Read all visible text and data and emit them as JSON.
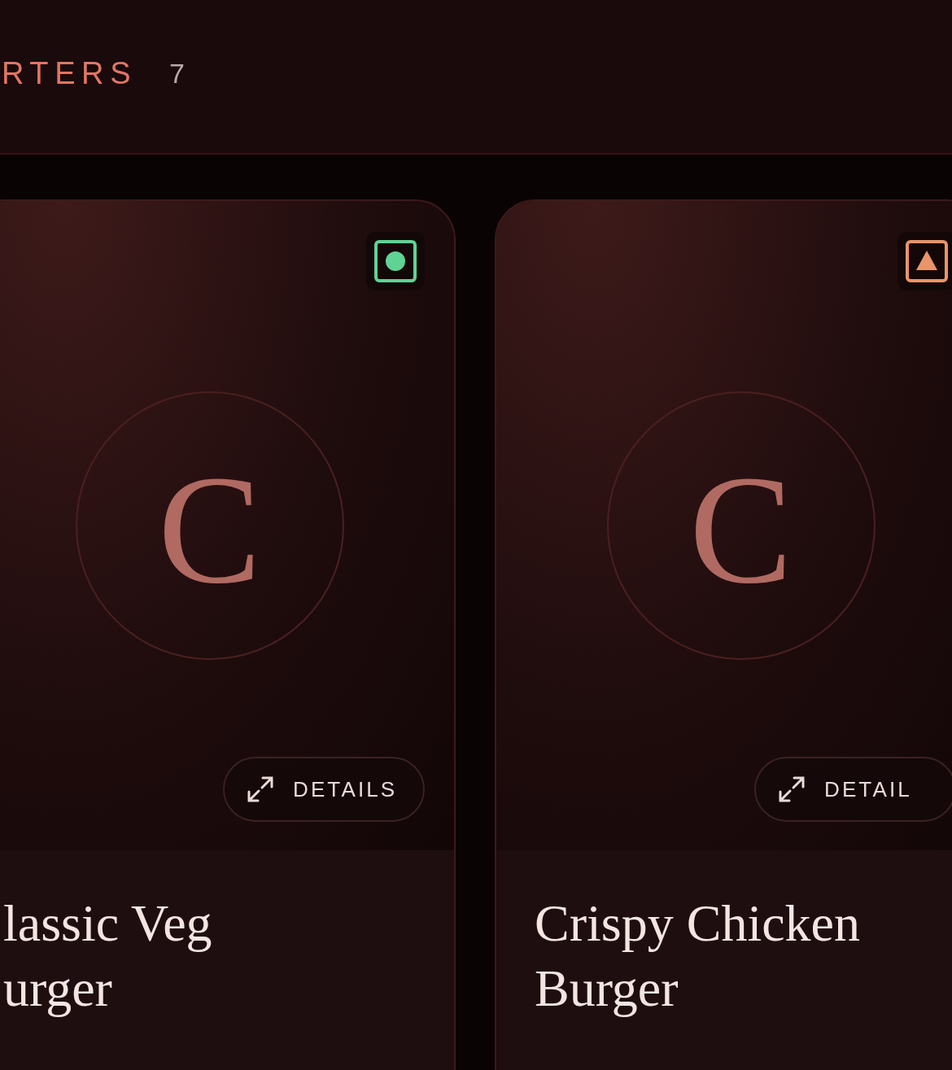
{
  "section": {
    "title": "RTERS",
    "count": "7"
  },
  "items": [
    {
      "initial": "C",
      "kind": "veg",
      "button": "DETAILS",
      "title_lines": [
        "lassic Veg",
        "urger"
      ]
    },
    {
      "initial": "C",
      "kind": "non-veg",
      "button": "DETAIL",
      "title_lines": [
        "Crispy Chicken",
        "Burger"
      ]
    }
  ]
}
